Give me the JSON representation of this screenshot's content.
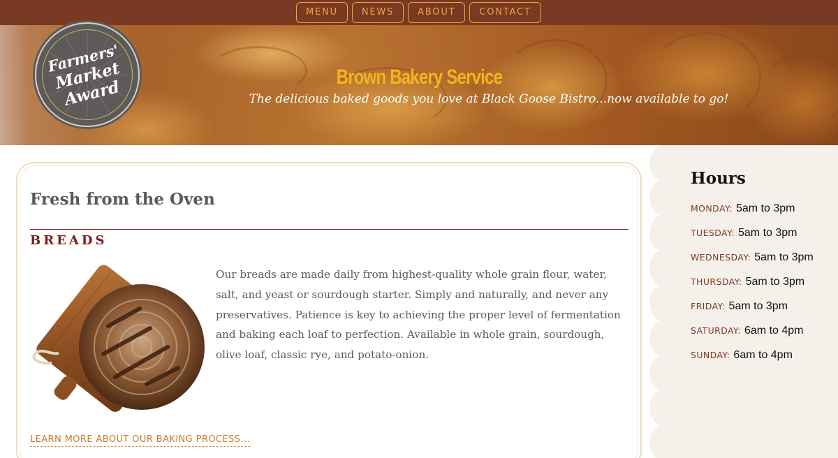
{
  "nav": {
    "items": [
      {
        "label": "MENU"
      },
      {
        "label": "NEWS"
      },
      {
        "label": "ABOUT"
      },
      {
        "label": "CONTACT"
      }
    ]
  },
  "hero": {
    "title": "Brown Bakery Service",
    "subtitle": "The delicious baked goods you love at Black Goose Bistro...now available to go!",
    "award_lines": [
      "Farmers'",
      "Market",
      "Award"
    ]
  },
  "main": {
    "section_title": "Fresh from the Oven",
    "breads": {
      "heading": "BREADS",
      "image_icon": "bread-on-cutting-board",
      "text": "Our breads are made daily from highest-quality whole grain flour, water, salt, and yeast or sourdough starter. Simply and naturally, and never any preservatives. Patience is key to achieving the proper level of fermentation and baking each loaf to perfection. Available in whole grain, sourdough, olive loaf, classic rye, and potato-onion.",
      "learn_more": "LEARN MORE ABOUT OUR BAKING PROCESS..."
    }
  },
  "hours": {
    "title": "Hours",
    "days": [
      {
        "day": "MONDAY:",
        "time": "5am to 3pm"
      },
      {
        "day": "TUESDAY:",
        "time": "5am to 3pm"
      },
      {
        "day": "WEDNESDAY:",
        "time": "5am to 3pm"
      },
      {
        "day": "THURSDAY:",
        "time": "5am to 3pm"
      },
      {
        "day": "FRIDAY:",
        "time": "5am to 3pm"
      },
      {
        "day": "SATURDAY:",
        "time": "6am to 4pm"
      },
      {
        "day": "SUNDAY:",
        "time": "6am to 4pm"
      }
    ]
  },
  "colors": {
    "nav_bg": "#783a22",
    "nav_accent": "#f2a53a",
    "title_gold": "#f2b51e",
    "heading_red": "#7a1f1f",
    "link_orange": "#c97a2c",
    "sidebar_bg": "#f5f1ea"
  }
}
